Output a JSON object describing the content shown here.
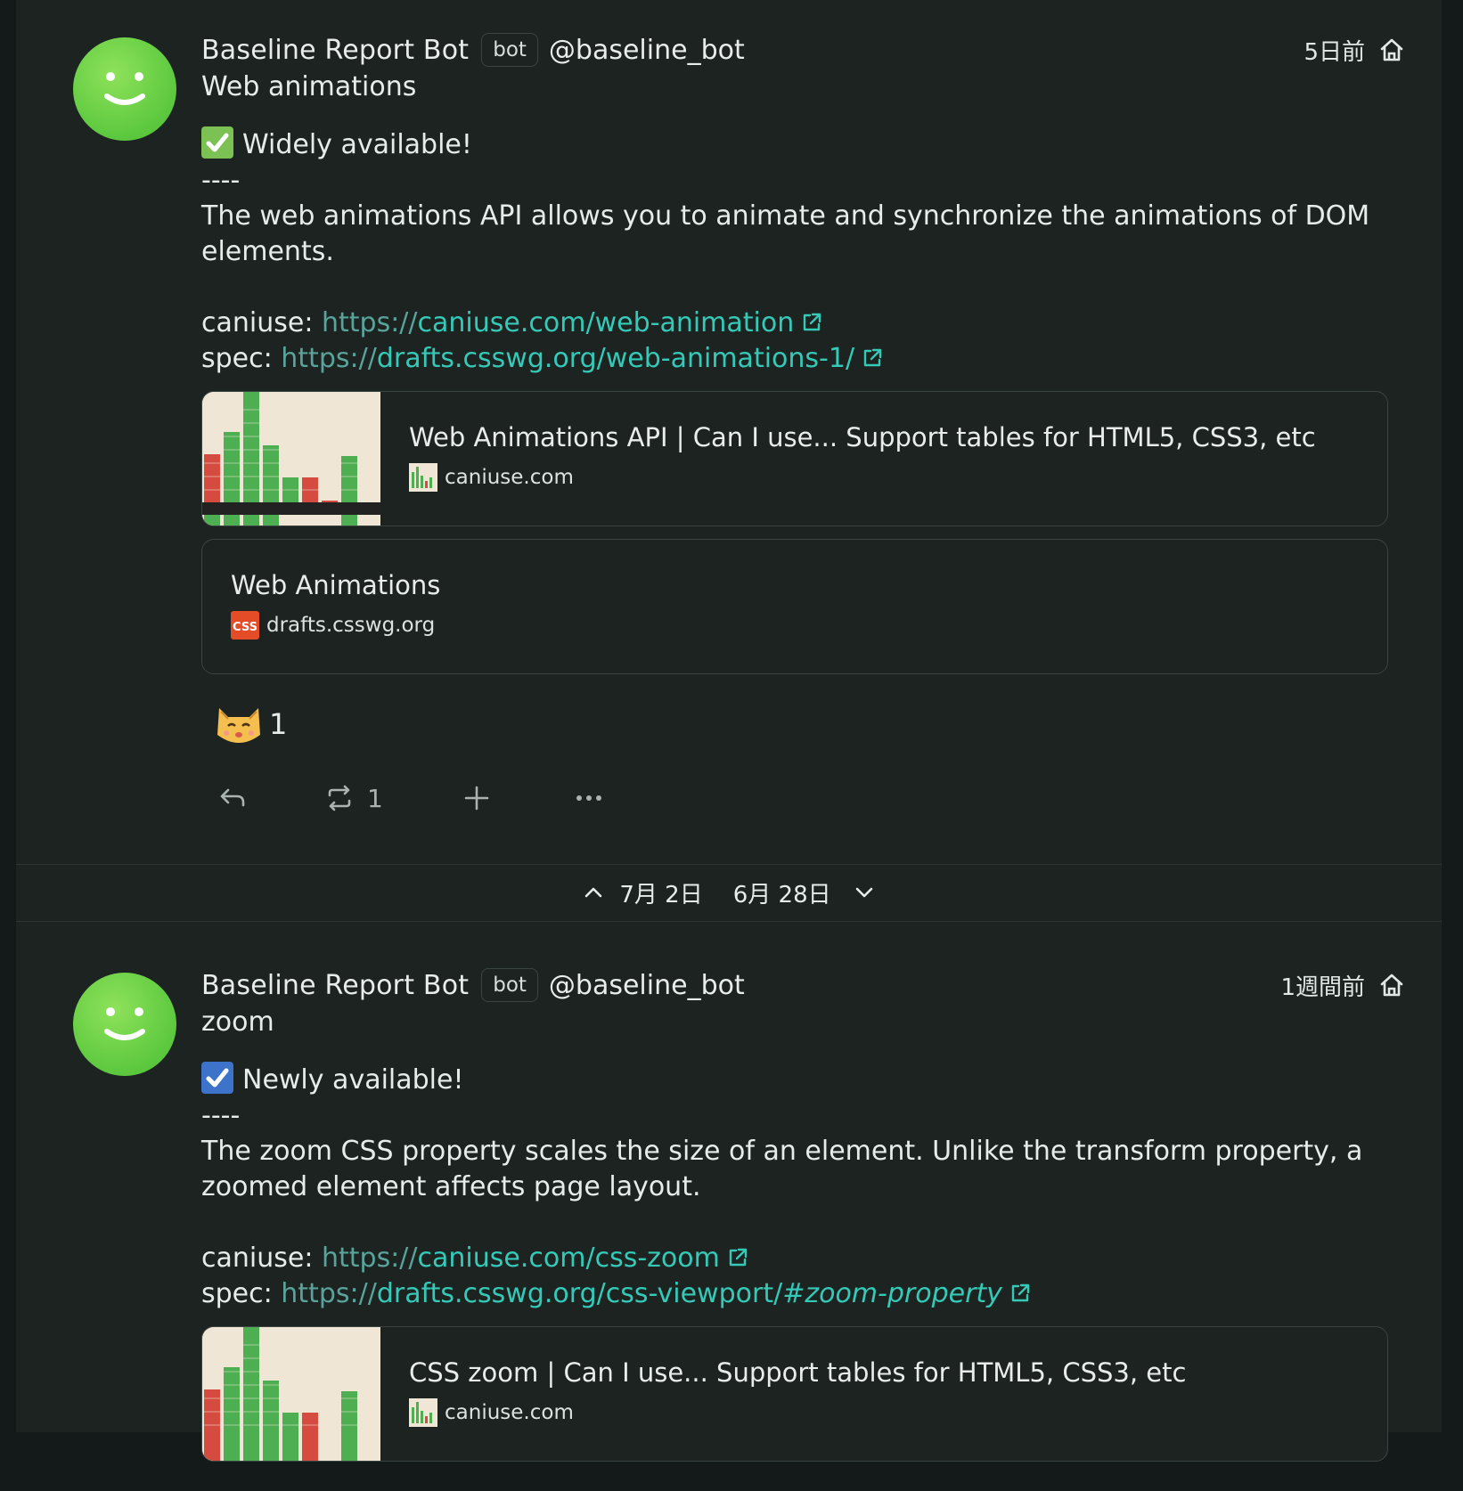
{
  "notes": [
    {
      "user": {
        "display_name": "Baseline Report Bot",
        "badge": "bot",
        "handle": "@baseline_bot"
      },
      "time": "5日前",
      "visibility_icon": "home-icon",
      "cw": "Web animations",
      "status_icon": "check-mark-button-green",
      "status": "Widely available!",
      "separator": "----",
      "description": "The web animations API allows you to animate and synchronize the animations of DOM elements.",
      "caniuse_label": "caniuse: ",
      "caniuse_link": {
        "scheme": "https://",
        "host": "caniuse.com",
        "path": "/web-animation"
      },
      "spec_label": "spec: ",
      "spec_link": {
        "scheme": "https://",
        "host": "drafts.csswg.org",
        "path": "/web-animations-1/",
        "hash": ""
      },
      "cards": [
        {
          "title": "Web Animations API | Can I use... Support tables for HTML5, CSS3, etc",
          "site": "caniuse.com",
          "has_thumb": true
        },
        {
          "title": "Web Animations",
          "site": "drafts.csswg.org",
          "has_thumb": false
        }
      ],
      "reaction": {
        "emoji": "cat-face-emoji",
        "count": "1"
      },
      "actions": {
        "renote_count": "1"
      }
    },
    {
      "user": {
        "display_name": "Baseline Report Bot",
        "badge": "bot",
        "handle": "@baseline_bot"
      },
      "time": "1週間前",
      "visibility_icon": "home-icon",
      "cw": "zoom",
      "status_icon": "check-box-blue",
      "status": "Newly available!",
      "separator": "----",
      "description": "The zoom CSS property scales the size of an element. Unlike the transform property, a zoomed element affects page layout.",
      "caniuse_label": "caniuse: ",
      "caniuse_link": {
        "scheme": "https://",
        "host": "caniuse.com",
        "path": "/css-zoom"
      },
      "spec_label": "spec: ",
      "spec_link": {
        "scheme": "https://",
        "host": "drafts.csswg.org",
        "path": "/css-viewport/",
        "hash": "#zoom-property"
      },
      "cards": [
        {
          "title": "CSS zoom | Can I use... Support tables for HTML5, CSS3, etc",
          "site": "caniuse.com",
          "has_thumb": true
        }
      ]
    }
  ],
  "date_separator": {
    "prev": "7月 2日",
    "next": "6月 28日"
  },
  "colors": {
    "background": "#1c2321",
    "link": "#35c9b7",
    "avatar": "#5cc83e"
  }
}
